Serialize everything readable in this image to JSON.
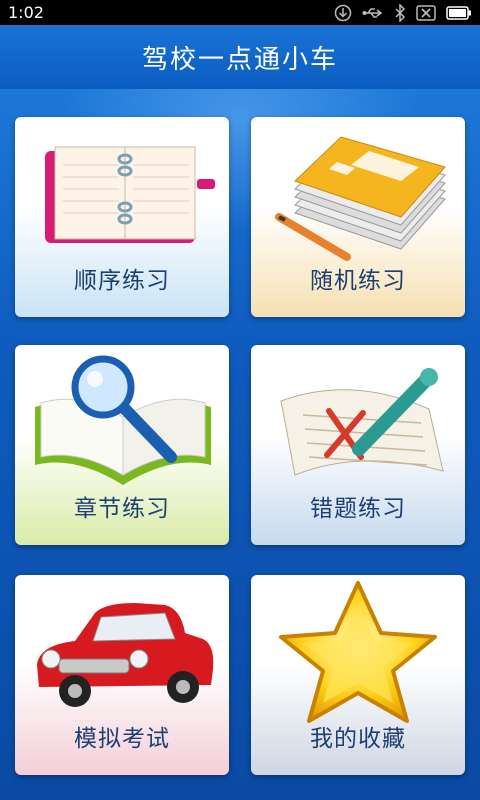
{
  "status_bar": {
    "time": "1:02"
  },
  "header": {
    "title": "驾校一点通小车"
  },
  "menu": {
    "items": [
      {
        "label": "顺序练习"
      },
      {
        "label": "随机练习"
      },
      {
        "label": "章节练习"
      },
      {
        "label": "错题练习"
      },
      {
        "label": "模拟考试"
      },
      {
        "label": "我的收藏"
      }
    ]
  }
}
